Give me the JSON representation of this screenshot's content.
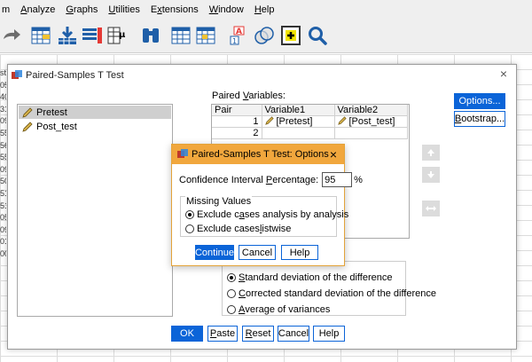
{
  "menubar": {
    "items": [
      {
        "label": "m"
      },
      {
        "label": "Analyze",
        "underline": "A",
        "rest": "nalyze"
      },
      {
        "label": "Graphs",
        "underline": "G",
        "rest": "raphs"
      },
      {
        "label": "Utilities",
        "underline": "U",
        "rest": "tilities"
      },
      {
        "label": "Extensions",
        "underline": "x",
        "pre": "E",
        "rest": "tensions"
      },
      {
        "label": "Window",
        "underline": "W",
        "rest": "indow"
      },
      {
        "label": "Help",
        "underline": "H",
        "rest": "elp"
      }
    ]
  },
  "toolbar": {
    "icons": [
      "undo-icon",
      "goto-case-icon",
      "import-icon",
      "variables-icon",
      "goto-variable-icon",
      "find-icon",
      "split-file-icon",
      "select-cases-icon",
      "value-labels-icon",
      "use-sets-icon",
      "spelling-icon",
      "search-icon"
    ]
  },
  "row_numbers": [
    "st",
    "05",
    "40",
    "31",
    "09",
    "55",
    "56",
    "55",
    "09",
    "50",
    "51",
    "51",
    "05",
    "09",
    "01",
    "00"
  ],
  "main_dialog": {
    "title": "Paired-Samples T Test",
    "close_glyph": "×",
    "variables": [
      {
        "name": "Pretest",
        "selected": true
      },
      {
        "name": "Post_test",
        "selected": false
      }
    ],
    "paired_label_pre": "Paired ",
    "paired_label_u": "V",
    "paired_label_post": "ariables:",
    "table_headers": [
      "Pair",
      "Variable1",
      "Variable2"
    ],
    "pairs": [
      {
        "num": "1",
        "v1": "[Pretest]",
        "v2": "[Post_test]"
      },
      {
        "num": "2",
        "v1": "",
        "v2": ""
      }
    ],
    "options_button": "Options...",
    "bootstrap_button_u": "B",
    "bootstrap_button_rest": "ootstrap...",
    "sd_options": [
      {
        "u": "S",
        "rest": "tandard deviation of the difference",
        "selected": true
      },
      {
        "u": "C",
        "rest": "orrected standard deviation of the difference",
        "selected": false
      },
      {
        "u": "A",
        "rest": "verage of variances",
        "selected": false
      }
    ],
    "buttons": {
      "ok": "OK",
      "paste_u": "P",
      "paste_rest": "aste",
      "reset_u": "R",
      "reset_rest": "eset",
      "cancel": "Cancel",
      "help": "Help"
    }
  },
  "options_dialog": {
    "title": "Paired-Samples T Test: Options",
    "close_glyph": "×",
    "ci_label_pre": "Confidence Interval ",
    "ci_label_u": "P",
    "ci_label_post": "ercentage:",
    "ci_value": "95",
    "ci_suffix": "%",
    "missing_values_legend": "Missing Values",
    "mv_option1_pre": "Exclude c",
    "mv_option1_u": "a",
    "mv_option1_post": "ses analysis by analysis",
    "mv_option1_selected": true,
    "mv_option2_pre": "Exclude cases ",
    "mv_option2_u": "l",
    "mv_option2_post": "istwise",
    "mv_option2_selected": false,
    "buttons": {
      "continue": "Continue",
      "cancel": "Cancel",
      "help": "Help"
    }
  },
  "colors": {
    "accent_blue": "#0b64d8",
    "options_title_bg": "#f1a73d",
    "selected_item_bg": "#cfcfcf"
  }
}
